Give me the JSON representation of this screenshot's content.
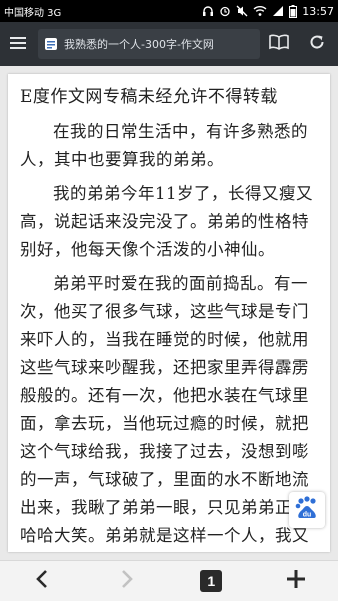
{
  "status_bar": {
    "carrier": "中国移动 3G",
    "time": "13:57"
  },
  "toolbar": {
    "page_title": "我熟悉的一个人-300字-作文网"
  },
  "article": {
    "title": "E度作文网专稿未经允许不得转载",
    "paragraphs": [
      "在我的日常生活中，有许多熟悉的人，其中也要算我的弟弟。",
      "我的弟弟今年11岁了，长得又瘦又高，说起话来没完没了。弟弟的性格特别好，他每天像个活泼的小神仙。",
      "弟弟平时爱在我的面前捣乱。有一次，他买了很多气球，这些气球是专门来吓人的，当我在睡觉的时候，他就用这些气球来吵醒我，还把家里弄得霹雳般般的。还有一次，他把水装在气球里面，拿去玩，当他玩过瘾的时候，就把这个气球给我，我接了过去，没想到嘭的一声，气球破了，里面的水不断地流出来，我瞅了弟弟一眼，只见弟弟正在哈哈大笑。弟弟就是这样一个人，我又能拿他怎么样？"
    ]
  },
  "badge": {
    "label": "du"
  },
  "bottom_nav": {
    "tab_count": "1"
  },
  "colors": {
    "toolbar_bg": "#2d3136",
    "baidu_blue": "#2f6fd6"
  }
}
